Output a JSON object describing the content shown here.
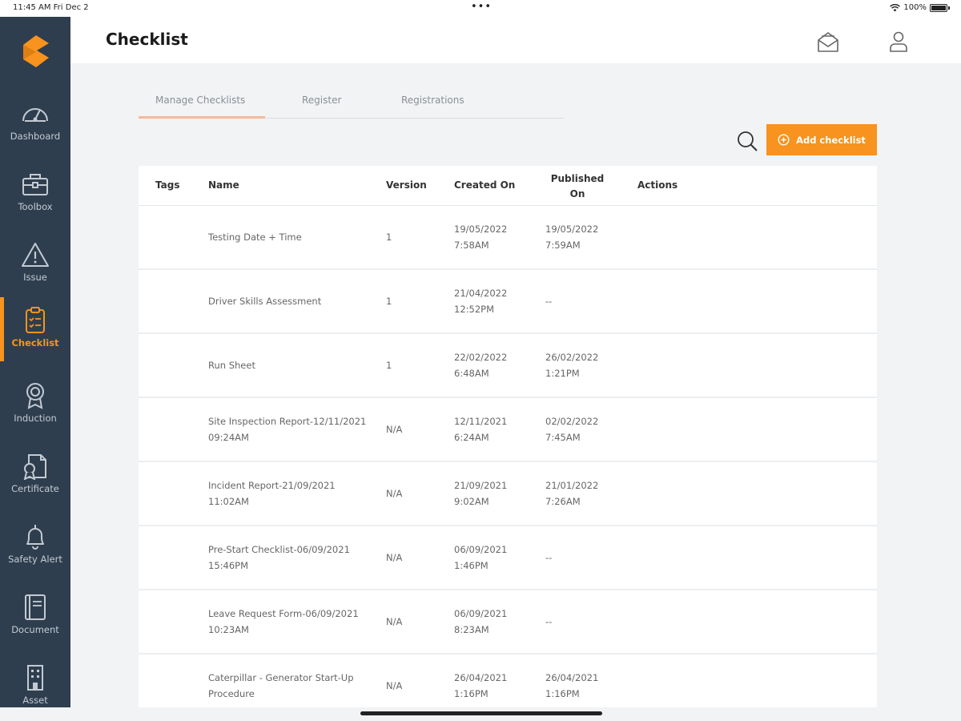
{
  "status_bar": {
    "time": "11:45 AM  Fri Dec 2",
    "dots": "•••",
    "battery": "100%"
  },
  "sidebar": {
    "items": [
      {
        "label": "Dashboard",
        "icon": "gauge-icon"
      },
      {
        "label": "Toolbox",
        "icon": "toolbox-icon"
      },
      {
        "label": "Issue",
        "icon": "warning-icon"
      },
      {
        "label": "Checklist",
        "icon": "clipboard-icon",
        "active": true
      },
      {
        "label": "Induction",
        "icon": "award-icon"
      },
      {
        "label": "Certificate",
        "icon": "certificate-icon"
      },
      {
        "label": "Safety Alert",
        "icon": "bell-icon"
      },
      {
        "label": "Document",
        "icon": "book-icon"
      },
      {
        "label": "Asset",
        "icon": "building-icon"
      }
    ]
  },
  "header": {
    "title": "Checklist"
  },
  "tabs": [
    {
      "label": "Manage Checklists",
      "active": true
    },
    {
      "label": "Register"
    },
    {
      "label": "Registrations"
    }
  ],
  "toolbar": {
    "add_label": "Add checklist"
  },
  "table": {
    "headers": {
      "tags": "Tags",
      "name": "Name",
      "version": "Version",
      "created": "Created On",
      "published_1": "Published",
      "published_2": "On",
      "actions": "Actions"
    },
    "rows": [
      {
        "name1": "Testing Date + Time",
        "name2": "",
        "version": "1",
        "created1": "19/05/2022",
        "created2": "7:58AM",
        "pub1": "19/05/2022",
        "pub2": "7:59AM"
      },
      {
        "name1": "Driver Skills Assessment",
        "name2": "",
        "version": "1",
        "created1": "21/04/2022",
        "created2": "12:52PM",
        "pub1": "--",
        "pub2": ""
      },
      {
        "name1": "Run Sheet",
        "name2": "",
        "version": "1",
        "created1": "22/02/2022",
        "created2": "6:48AM",
        "pub1": "26/02/2022",
        "pub2": "1:21PM"
      },
      {
        "name1": "Site Inspection Report-12/11/2021",
        "name2": "09:24AM",
        "version": "N/A",
        "created1": "12/11/2021",
        "created2": "6:24AM",
        "pub1": "02/02/2022",
        "pub2": "7:45AM"
      },
      {
        "name1": "Incident Report-21/09/2021",
        "name2": "11:02AM",
        "version": "N/A",
        "created1": "21/09/2021",
        "created2": "9:02AM",
        "pub1": "21/01/2022",
        "pub2": "7:26AM"
      },
      {
        "name1": "Pre-Start Checklist-06/09/2021",
        "name2": "15:46PM",
        "version": "N/A",
        "created1": "06/09/2021",
        "created2": "1:46PM",
        "pub1": "--",
        "pub2": ""
      },
      {
        "name1": "Leave Request Form-06/09/2021",
        "name2": "10:23AM",
        "version": "N/A",
        "created1": "06/09/2021",
        "created2": "8:23AM",
        "pub1": "--",
        "pub2": ""
      },
      {
        "name1": "Caterpillar - Generator Start-Up",
        "name2": "Procedure",
        "version": "N/A",
        "created1": "26/04/2021",
        "created2": "1:16PM",
        "pub1": "26/04/2021",
        "pub2": "1:16PM"
      }
    ]
  },
  "colors": {
    "accent": "#f7931e",
    "sidebar": "#2f3e4e",
    "background": "#f2f3f5"
  }
}
